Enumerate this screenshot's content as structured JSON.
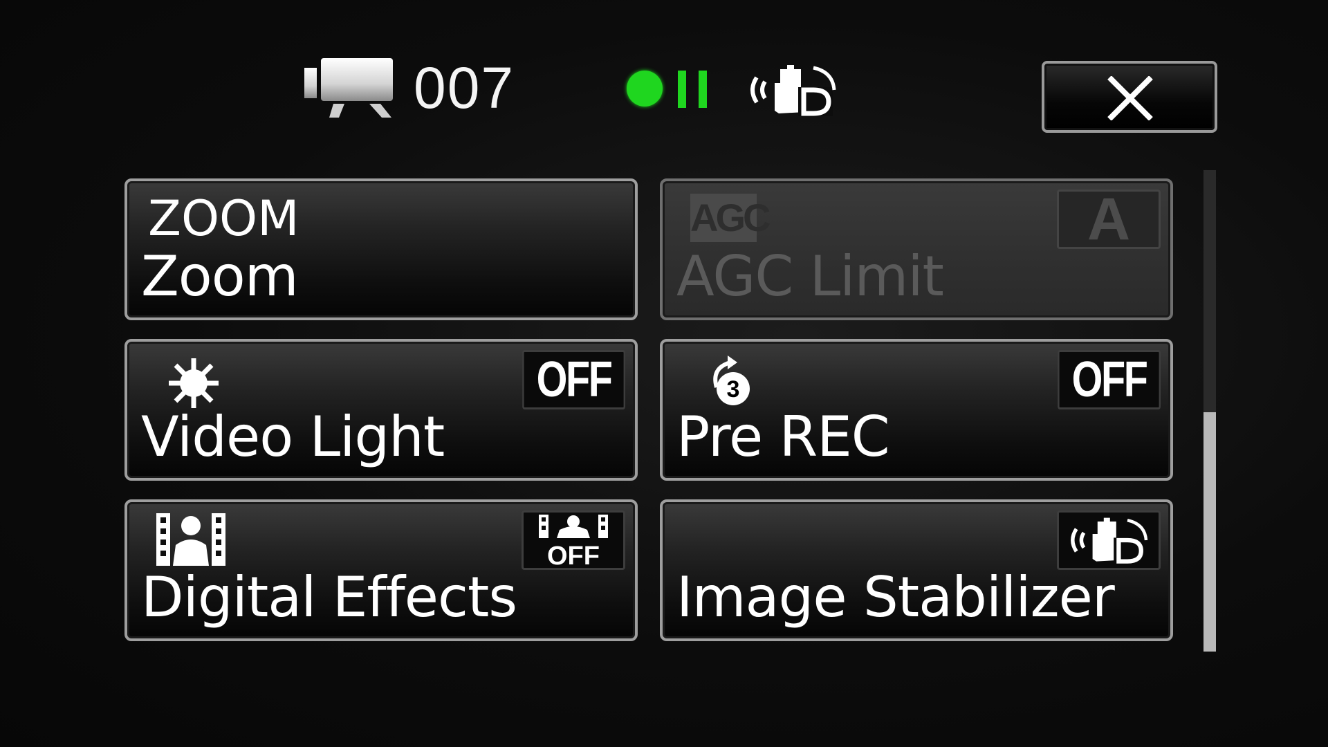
{
  "status_bar": {
    "camera_icon": "movie-camera-icon",
    "counter": "007",
    "record_icon": "record-dot-icon",
    "record_color": "#1fd61f",
    "pause_icon": "pause-icon",
    "stabilizer_icon": "dynamic-image-stabilizer-icon"
  },
  "close_button": {
    "icon": "close-icon"
  },
  "tiles": [
    {
      "id": "zoom",
      "icon_text": "ZOOM",
      "label": "Zoom",
      "enabled": true
    },
    {
      "id": "agc",
      "icon_text": "AGC",
      "label": "AGC Limit",
      "value": "A",
      "enabled": false
    },
    {
      "id": "video-light",
      "icon": "video-light-icon",
      "label": "Video Light",
      "value": "OFF",
      "enabled": true
    },
    {
      "id": "pre-rec",
      "icon": "pre-rec-icon",
      "icon_text": "3",
      "label": "Pre REC",
      "value": "OFF",
      "enabled": true
    },
    {
      "id": "digital-effects",
      "icon": "digital-effects-icon",
      "label": "Digital Effects",
      "value_icon": "digital-effects-off-icon",
      "value": "OFF",
      "enabled": true
    },
    {
      "id": "image-stabilizer",
      "icon": "image-stabilizer-icon",
      "label": "Image Stabilizer",
      "value_icon": "dynamic-image-stabilizer-icon",
      "enabled": true
    }
  ],
  "scrollbar": {
    "position": "bottom",
    "visible_fraction": 0.5
  }
}
